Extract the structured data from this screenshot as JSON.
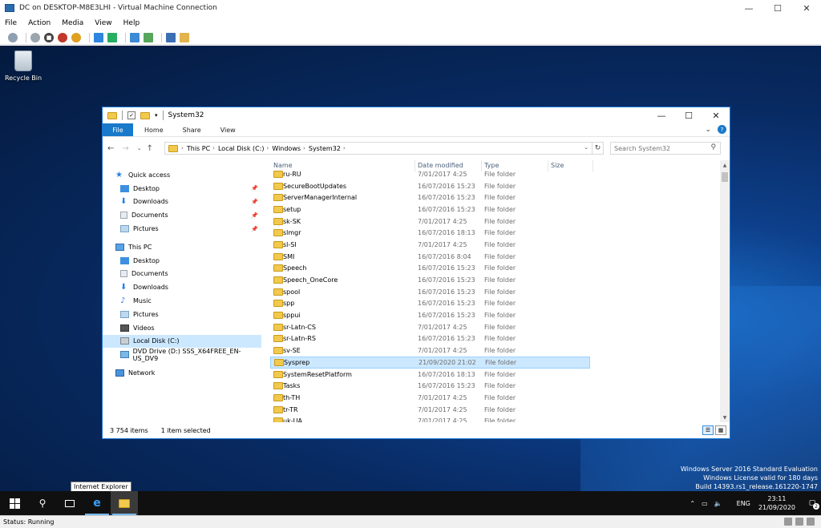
{
  "host": {
    "title": "DC on DESKTOP-M8E3LHI - Virtual Machine Connection",
    "controls": {
      "minimize": "—",
      "maximize": "☐",
      "close": "✕"
    },
    "menu": [
      "File",
      "Action",
      "Media",
      "View",
      "Help"
    ],
    "status": "Status: Running"
  },
  "desktop": {
    "recycle_bin_label": "Recycle Bin",
    "watermark": {
      "line1": "Windows Server 2016 Standard Evaluation",
      "line2": "Windows License valid for 180 days",
      "line3": "Build 14393.rs1_release.161220-1747"
    },
    "tooltip": "Internet Explorer"
  },
  "explorer": {
    "title": "System32",
    "controls": {
      "minimize": "—",
      "maximize": "☐",
      "close": "✕"
    },
    "ribbon": {
      "file": "File",
      "home": "Home",
      "share": "Share",
      "view": "View",
      "help": "?"
    },
    "address": {
      "crumbs": [
        "This PC",
        "Local Disk (C:)",
        "Windows",
        "System32"
      ],
      "search_placeholder": "Search System32"
    },
    "nav": {
      "quick_access": "Quick access",
      "qa_items": [
        "Desktop",
        "Downloads",
        "Documents",
        "Pictures"
      ],
      "this_pc": "This PC",
      "pc_items": [
        "Desktop",
        "Documents",
        "Downloads",
        "Music",
        "Pictures",
        "Videos",
        "Local Disk (C:)",
        "DVD Drive (D:) SSS_X64FREE_EN-US_DV9"
      ],
      "network": "Network"
    },
    "columns": {
      "name": "Name",
      "date": "Date modified",
      "type": "Type",
      "size": "Size"
    },
    "rows": [
      {
        "name": "ru-RU",
        "date": "7/01/2017 4:25",
        "type": "File folder"
      },
      {
        "name": "SecureBootUpdates",
        "date": "16/07/2016 15:23",
        "type": "File folder"
      },
      {
        "name": "ServerManagerInternal",
        "date": "16/07/2016 15:23",
        "type": "File folder"
      },
      {
        "name": "setup",
        "date": "16/07/2016 15:23",
        "type": "File folder"
      },
      {
        "name": "sk-SK",
        "date": "7/01/2017 4:25",
        "type": "File folder"
      },
      {
        "name": "slmgr",
        "date": "16/07/2016 18:13",
        "type": "File folder"
      },
      {
        "name": "sl-SI",
        "date": "7/01/2017 4:25",
        "type": "File folder"
      },
      {
        "name": "SMI",
        "date": "16/07/2016 8:04",
        "type": "File folder"
      },
      {
        "name": "Speech",
        "date": "16/07/2016 15:23",
        "type": "File folder"
      },
      {
        "name": "Speech_OneCore",
        "date": "16/07/2016 15:23",
        "type": "File folder"
      },
      {
        "name": "spool",
        "date": "16/07/2016 15:23",
        "type": "File folder"
      },
      {
        "name": "spp",
        "date": "16/07/2016 15:23",
        "type": "File folder"
      },
      {
        "name": "sppui",
        "date": "16/07/2016 15:23",
        "type": "File folder"
      },
      {
        "name": "sr-Latn-CS",
        "date": "7/01/2017 4:25",
        "type": "File folder"
      },
      {
        "name": "sr-Latn-RS",
        "date": "16/07/2016 15:23",
        "type": "File folder"
      },
      {
        "name": "sv-SE",
        "date": "7/01/2017 4:25",
        "type": "File folder"
      },
      {
        "name": "Sysprep",
        "date": "21/09/2020 21:02",
        "type": "File folder"
      },
      {
        "name": "SystemResetPlatform",
        "date": "16/07/2016 18:13",
        "type": "File folder"
      },
      {
        "name": "Tasks",
        "date": "16/07/2016 15:23",
        "type": "File folder"
      },
      {
        "name": "th-TH",
        "date": "7/01/2017 4:25",
        "type": "File folder"
      },
      {
        "name": "tr-TR",
        "date": "7/01/2017 4:25",
        "type": "File folder"
      },
      {
        "name": "uk-UA",
        "date": "7/01/2017 4:25",
        "type": "File folder"
      }
    ],
    "status": {
      "count": "3 754 items",
      "selected": "1 item selected"
    }
  },
  "taskbar": {
    "lang": "ENG",
    "time": "23:11",
    "date": "21/09/2020",
    "notifications": "2"
  },
  "colors": {
    "accent": "#1979ca",
    "selection": "#cce8ff",
    "folder": "#f2c94c"
  }
}
